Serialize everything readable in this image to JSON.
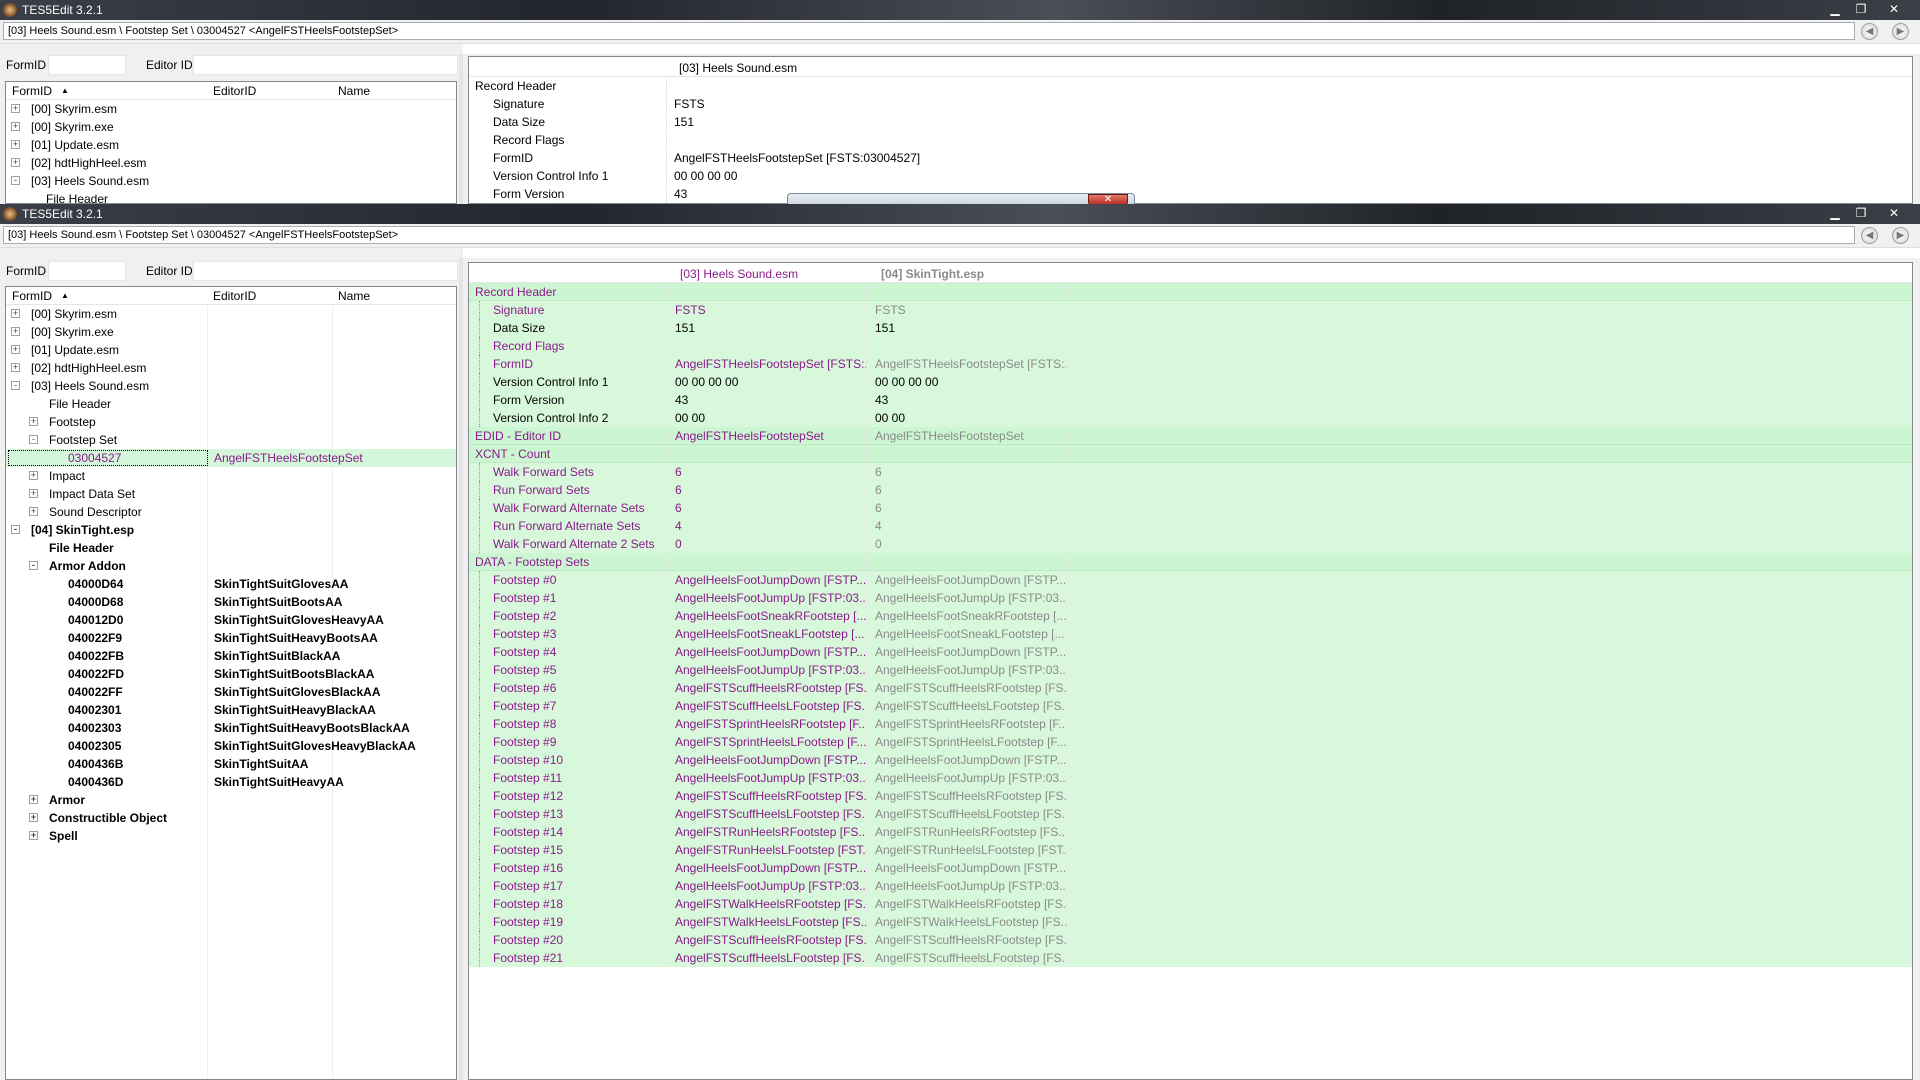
{
  "app_title": "TES5Edit 3.2.1",
  "path": "[03] Heels Sound.esm \\ Footstep Set \\ 03004527 <AngelFSTHeelsFootstepSet>",
  "filter": {
    "formid_label": "FormID",
    "editorid_label": "Editor ID"
  },
  "tree_headers": {
    "formid": "FormID",
    "editorid": "EditorID",
    "name": "Name"
  },
  "back_tree": [
    {
      "label": "[00] Skyrim.esm",
      "exp": "+"
    },
    {
      "label": "[00] Skyrim.exe",
      "exp": "+"
    },
    {
      "label": "[01] Update.esm",
      "exp": "+"
    },
    {
      "label": "[02] hdtHighHeel.esm",
      "exp": "+"
    },
    {
      "label": "[03] Heels Sound.esm",
      "exp": "-"
    },
    {
      "label": "File Header",
      "exp": ""
    }
  ],
  "back_grid": {
    "col_header": "[03] Heels Sound.esm",
    "rows": [
      {
        "k": "Record Header",
        "v": ""
      },
      {
        "k": "Signature",
        "v": "FSTS"
      },
      {
        "k": "Data Size",
        "v": "151"
      },
      {
        "k": "Record Flags",
        "v": ""
      },
      {
        "k": "FormID",
        "v": "AngelFSTHeelsFootstepSet [FSTS:03004527]"
      },
      {
        "k": "Version Control Info 1",
        "v": "00 00 00 00"
      },
      {
        "k": "Form Version",
        "v": "43"
      }
    ]
  },
  "tree": [
    {
      "label": "[00] Skyrim.esm",
      "exp": "+",
      "indent": 0,
      "name": "",
      "bold": false
    },
    {
      "label": "[00] Skyrim.exe",
      "exp": "+",
      "indent": 0,
      "name": "",
      "bold": false
    },
    {
      "label": "[01] Update.esm",
      "exp": "+",
      "indent": 0,
      "name": "",
      "bold": false
    },
    {
      "label": "[02] hdtHighHeel.esm",
      "exp": "+",
      "indent": 0,
      "name": "",
      "bold": false
    },
    {
      "label": "[03] Heels Sound.esm",
      "exp": "-",
      "indent": 0,
      "name": "",
      "bold": false
    },
    {
      "label": "File Header",
      "exp": "",
      "indent": 1,
      "name": "",
      "bold": false
    },
    {
      "label": "Footstep",
      "exp": "+",
      "indent": 1,
      "name": "",
      "bold": false
    },
    {
      "label": "Footstep Set",
      "exp": "-",
      "indent": 1,
      "name": "",
      "bold": false
    },
    {
      "label": "03004527",
      "exp": "",
      "indent": 2,
      "name": "AngelFSTHeelsFootstepSet",
      "bold": false,
      "selected": true
    },
    {
      "label": "Impact",
      "exp": "+",
      "indent": 1,
      "name": "",
      "bold": false
    },
    {
      "label": "Impact Data Set",
      "exp": "+",
      "indent": 1,
      "name": "",
      "bold": false
    },
    {
      "label": "Sound Descriptor",
      "exp": "+",
      "indent": 1,
      "name": "",
      "bold": false
    },
    {
      "label": "[04] SkinTight.esp",
      "exp": "-",
      "indent": 0,
      "name": "",
      "bold": true
    },
    {
      "label": "File Header",
      "exp": "",
      "indent": 1,
      "name": "",
      "bold": true
    },
    {
      "label": "Armor Addon",
      "exp": "-",
      "indent": 1,
      "name": "",
      "bold": true
    },
    {
      "label": "04000D64",
      "exp": "",
      "indent": 2,
      "name": "SkinTightSuitGlovesAA",
      "bold": true
    },
    {
      "label": "04000D68",
      "exp": "",
      "indent": 2,
      "name": "SkinTightSuitBootsAA",
      "bold": true
    },
    {
      "label": "040012D0",
      "exp": "",
      "indent": 2,
      "name": "SkinTightSuitGlovesHeavyAA",
      "bold": true
    },
    {
      "label": "040022F9",
      "exp": "",
      "indent": 2,
      "name": "SkinTightSuitHeavyBootsAA",
      "bold": true
    },
    {
      "label": "040022FB",
      "exp": "",
      "indent": 2,
      "name": "SkinTightSuitBlackAA",
      "bold": true
    },
    {
      "label": "040022FD",
      "exp": "",
      "indent": 2,
      "name": "SkinTightSuitBootsBlackAA",
      "bold": true
    },
    {
      "label": "040022FF",
      "exp": "",
      "indent": 2,
      "name": "SkinTightSuitGlovesBlackAA",
      "bold": true
    },
    {
      "label": "04002301",
      "exp": "",
      "indent": 2,
      "name": "SkinTightSuitHeavyBlackAA",
      "bold": true
    },
    {
      "label": "04002303",
      "exp": "",
      "indent": 2,
      "name": "SkinTightSuitHeavyBootsBlackAA",
      "bold": true
    },
    {
      "label": "04002305",
      "exp": "",
      "indent": 2,
      "name": "SkinTightSuitGlovesHeavyBlackAA",
      "bold": true
    },
    {
      "label": "0400436B",
      "exp": "",
      "indent": 2,
      "name": "SkinTightSuitAA",
      "bold": true
    },
    {
      "label": "0400436D",
      "exp": "",
      "indent": 2,
      "name": "SkinTightSuitHeavyAA",
      "bold": true
    },
    {
      "label": "Armor",
      "exp": "+",
      "indent": 1,
      "name": "",
      "bold": true
    },
    {
      "label": "Constructible Object",
      "exp": "+",
      "indent": 1,
      "name": "",
      "bold": true
    },
    {
      "label": "Spell",
      "exp": "+",
      "indent": 1,
      "name": "",
      "bold": true
    }
  ],
  "grid": {
    "col1_header": "[03] Heels Sound.esm",
    "col2_header": "[04] SkinTight.esp",
    "rows": [
      {
        "k": "Record Header",
        "a": "",
        "b": "",
        "sub": false
      },
      {
        "k": "Signature",
        "a": "FSTS",
        "b": "FSTS",
        "sub": true
      },
      {
        "k": "Data Size",
        "a": "151",
        "b": "151",
        "sub": true,
        "black": true
      },
      {
        "k": "Record Flags",
        "a": "",
        "b": "",
        "sub": true
      },
      {
        "k": "FormID",
        "a": "AngelFSTHeelsFootstepSet [FSTS:...",
        "b": "AngelFSTHeelsFootstepSet [FSTS:...",
        "sub": true
      },
      {
        "k": "Version Control Info 1",
        "a": "00 00 00 00",
        "b": "00 00 00 00",
        "sub": true,
        "black": true
      },
      {
        "k": "Form Version",
        "a": "43",
        "b": "43",
        "sub": true,
        "black": true
      },
      {
        "k": "Version Control Info 2",
        "a": "00 00",
        "b": "00 00",
        "sub": true,
        "black": true
      },
      {
        "k": "EDID - Editor ID",
        "a": "AngelFSTHeelsFootstepSet",
        "b": "AngelFSTHeelsFootstepSet",
        "sub": false
      },
      {
        "k": "XCNT - Count",
        "a": "",
        "b": "",
        "sub": false
      },
      {
        "k": "Walk Forward Sets",
        "a": "6",
        "b": "6",
        "sub": true
      },
      {
        "k": "Run Forward Sets",
        "a": "6",
        "b": "6",
        "sub": true
      },
      {
        "k": "Walk Forward Alternate Sets",
        "a": "6",
        "b": "6",
        "sub": true
      },
      {
        "k": "Run Forward Alternate Sets",
        "a": "4",
        "b": "4",
        "sub": true
      },
      {
        "k": "Walk Forward Alternate 2 Sets",
        "a": "0",
        "b": "0",
        "sub": true
      },
      {
        "k": "DATA - Footstep Sets",
        "a": "",
        "b": "",
        "sub": false
      },
      {
        "k": "Footstep #0",
        "a": "AngelHeelsFootJumpDown [FSTP...",
        "b": "AngelHeelsFootJumpDown [FSTP...",
        "sub": true
      },
      {
        "k": "Footstep #1",
        "a": "AngelHeelsFootJumpUp [FSTP:03...",
        "b": "AngelHeelsFootJumpUp [FSTP:03...",
        "sub": true
      },
      {
        "k": "Footstep #2",
        "a": "AngelHeelsFootSneakRFootstep [...",
        "b": "AngelHeelsFootSneakRFootstep [...",
        "sub": true
      },
      {
        "k": "Footstep #3",
        "a": "AngelHeelsFootSneakLFootstep [...",
        "b": "AngelHeelsFootSneakLFootstep [...",
        "sub": true
      },
      {
        "k": "Footstep #4",
        "a": "AngelHeelsFootJumpDown [FSTP...",
        "b": "AngelHeelsFootJumpDown [FSTP...",
        "sub": true
      },
      {
        "k": "Footstep #5",
        "a": "AngelHeelsFootJumpUp [FSTP:03...",
        "b": "AngelHeelsFootJumpUp [FSTP:03...",
        "sub": true
      },
      {
        "k": "Footstep #6",
        "a": "AngelFSTScuffHeelsRFootstep [FS...",
        "b": "AngelFSTScuffHeelsRFootstep [FS...",
        "sub": true
      },
      {
        "k": "Footstep #7",
        "a": "AngelFSTScuffHeelsLFootstep [FS...",
        "b": "AngelFSTScuffHeelsLFootstep [FS...",
        "sub": true
      },
      {
        "k": "Footstep #8",
        "a": "AngelFSTSprintHeelsRFootstep [F...",
        "b": "AngelFSTSprintHeelsRFootstep [F...",
        "sub": true
      },
      {
        "k": "Footstep #9",
        "a": "AngelFSTSprintHeelsLFootstep [F...",
        "b": "AngelFSTSprintHeelsLFootstep [F...",
        "sub": true
      },
      {
        "k": "Footstep #10",
        "a": "AngelHeelsFootJumpDown [FSTP...",
        "b": "AngelHeelsFootJumpDown [FSTP...",
        "sub": true
      },
      {
        "k": "Footstep #11",
        "a": "AngelHeelsFootJumpUp [FSTP:03...",
        "b": "AngelHeelsFootJumpUp [FSTP:03...",
        "sub": true
      },
      {
        "k": "Footstep #12",
        "a": "AngelFSTScuffHeelsRFootstep [FS...",
        "b": "AngelFSTScuffHeelsRFootstep [FS...",
        "sub": true
      },
      {
        "k": "Footstep #13",
        "a": "AngelFSTScuffHeelsLFootstep [FS...",
        "b": "AngelFSTScuffHeelsLFootstep [FS...",
        "sub": true
      },
      {
        "k": "Footstep #14",
        "a": "AngelFSTRunHeelsRFootstep [FS...",
        "b": "AngelFSTRunHeelsRFootstep [FS...",
        "sub": true
      },
      {
        "k": "Footstep #15",
        "a": "AngelFSTRunHeelsLFootstep [FST...",
        "b": "AngelFSTRunHeelsLFootstep [FST...",
        "sub": true
      },
      {
        "k": "Footstep #16",
        "a": "AngelHeelsFootJumpDown [FSTP...",
        "b": "AngelHeelsFootJumpDown [FSTP...",
        "sub": true
      },
      {
        "k": "Footstep #17",
        "a": "AngelHeelsFootJumpUp [FSTP:03...",
        "b": "AngelHeelsFootJumpUp [FSTP:03...",
        "sub": true
      },
      {
        "k": "Footstep #18",
        "a": "AngelFSTWalkHeelsRFootstep [FS...",
        "b": "AngelFSTWalkHeelsRFootstep [FS...",
        "sub": true
      },
      {
        "k": "Footstep #19",
        "a": "AngelFSTWalkHeelsLFootstep [FS...",
        "b": "AngelFSTWalkHeelsLFootstep [FS...",
        "sub": true
      },
      {
        "k": "Footstep #20",
        "a": "AngelFSTScuffHeelsRFootstep [FS...",
        "b": "AngelFSTScuffHeelsRFootstep [FS...",
        "sub": true
      },
      {
        "k": "Footstep #21",
        "a": "AngelFSTScuffHeelsLFootstep [FS...",
        "b": "AngelFSTScuffHeelsLFootstep [FS...",
        "sub": true
      }
    ]
  },
  "icons": {
    "back": "back-arrow-icon",
    "forward": "forward-arrow-icon",
    "app": "tes5edit-app-icon"
  },
  "colors": {
    "accent_purple": "#8a1a8a",
    "row_green": "#d8f8dc",
    "muted_gray": "#8a8a8a"
  }
}
